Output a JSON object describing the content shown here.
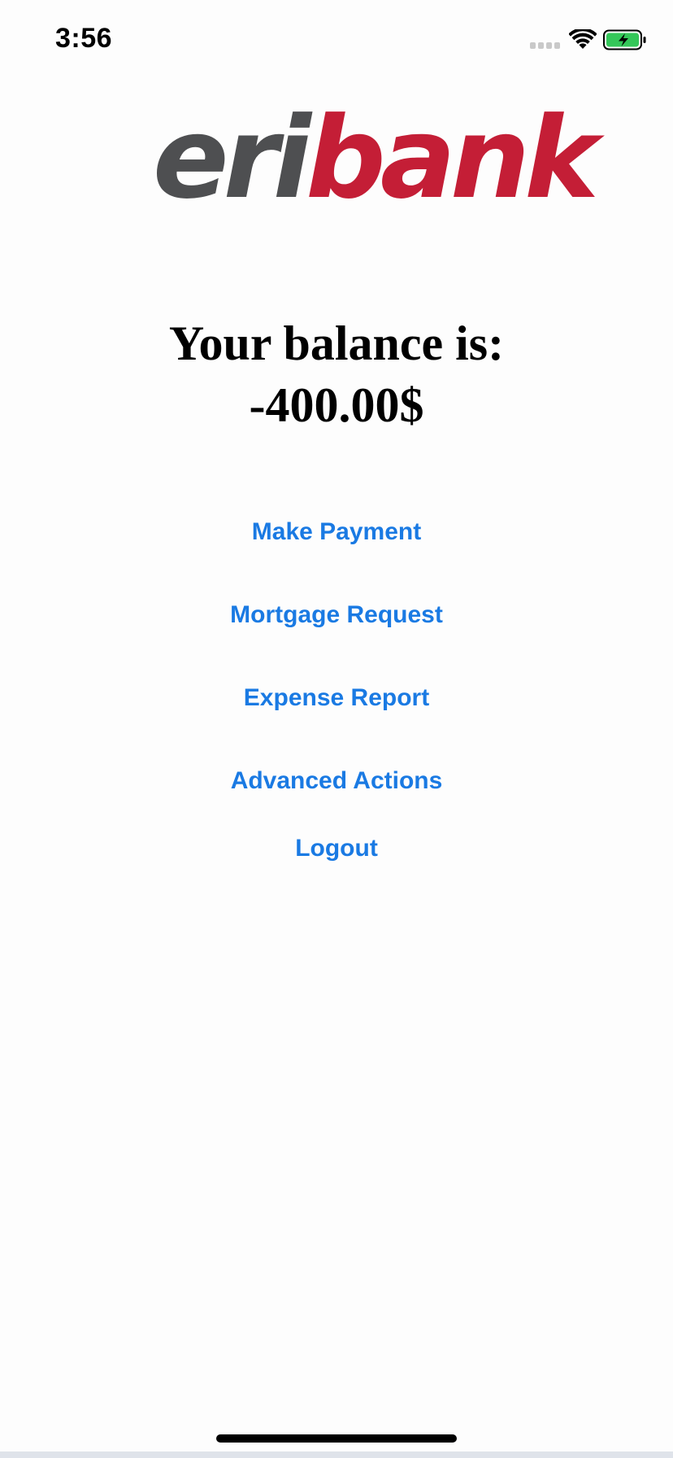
{
  "status_bar": {
    "time": "3:56",
    "icons": [
      "signal-icon",
      "wifi-icon",
      "battery-charging-icon"
    ],
    "battery_color": "#34c759"
  },
  "logo": {
    "part1": "eri",
    "part2": "bank",
    "colors": {
      "eri": "#4e4f51",
      "bank": "#c41e36"
    }
  },
  "balance": {
    "label": "Your balance is:",
    "amount": "-400.00$"
  },
  "actions": {
    "make_payment": "Make Payment",
    "mortgage_request": "Mortgage Request",
    "expense_report": "Expense Report",
    "advanced_actions": "Advanced Actions",
    "logout": "Logout"
  },
  "theme": {
    "link_color": "#1a7ae3",
    "background": "#fdfdfd"
  }
}
